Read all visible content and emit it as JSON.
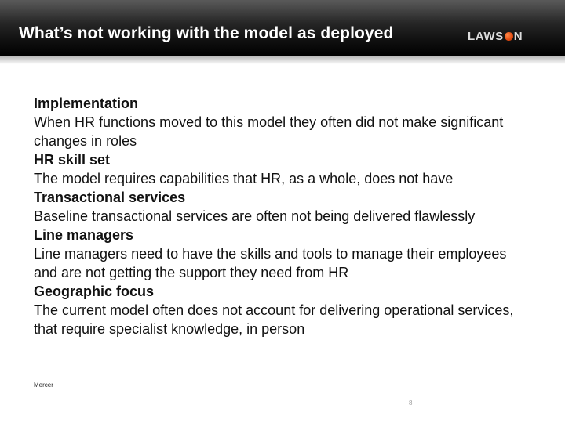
{
  "slide": {
    "title": "What’s not working with the model as deployed",
    "logo_text_left": "LAWS",
    "logo_text_right": "N",
    "sections": [
      {
        "heading": "Implementation",
        "body": "When HR functions moved to this model they often did not make significant changes in roles"
      },
      {
        "heading": "HR skill set",
        "body": "The model requires capabilities that HR, as a whole, does not have"
      },
      {
        "heading": "Transactional services",
        "body": "Baseline transactional services are often not being delivered flawlessly"
      },
      {
        "heading": "Line managers",
        "body": "Line managers need to have the skills and tools to manage their employees and are not getting the support they need from HR"
      },
      {
        "heading": "Geographic focus",
        "body": "The current model often does not account for delivering operational services, that require specialist knowledge, in person"
      }
    ],
    "source": "Mercer",
    "page_number": "8"
  },
  "colors": {
    "header_background": "#000000",
    "title_text": "#ffffff",
    "body_text": "#111111",
    "logo_accent": "#e04a10"
  }
}
